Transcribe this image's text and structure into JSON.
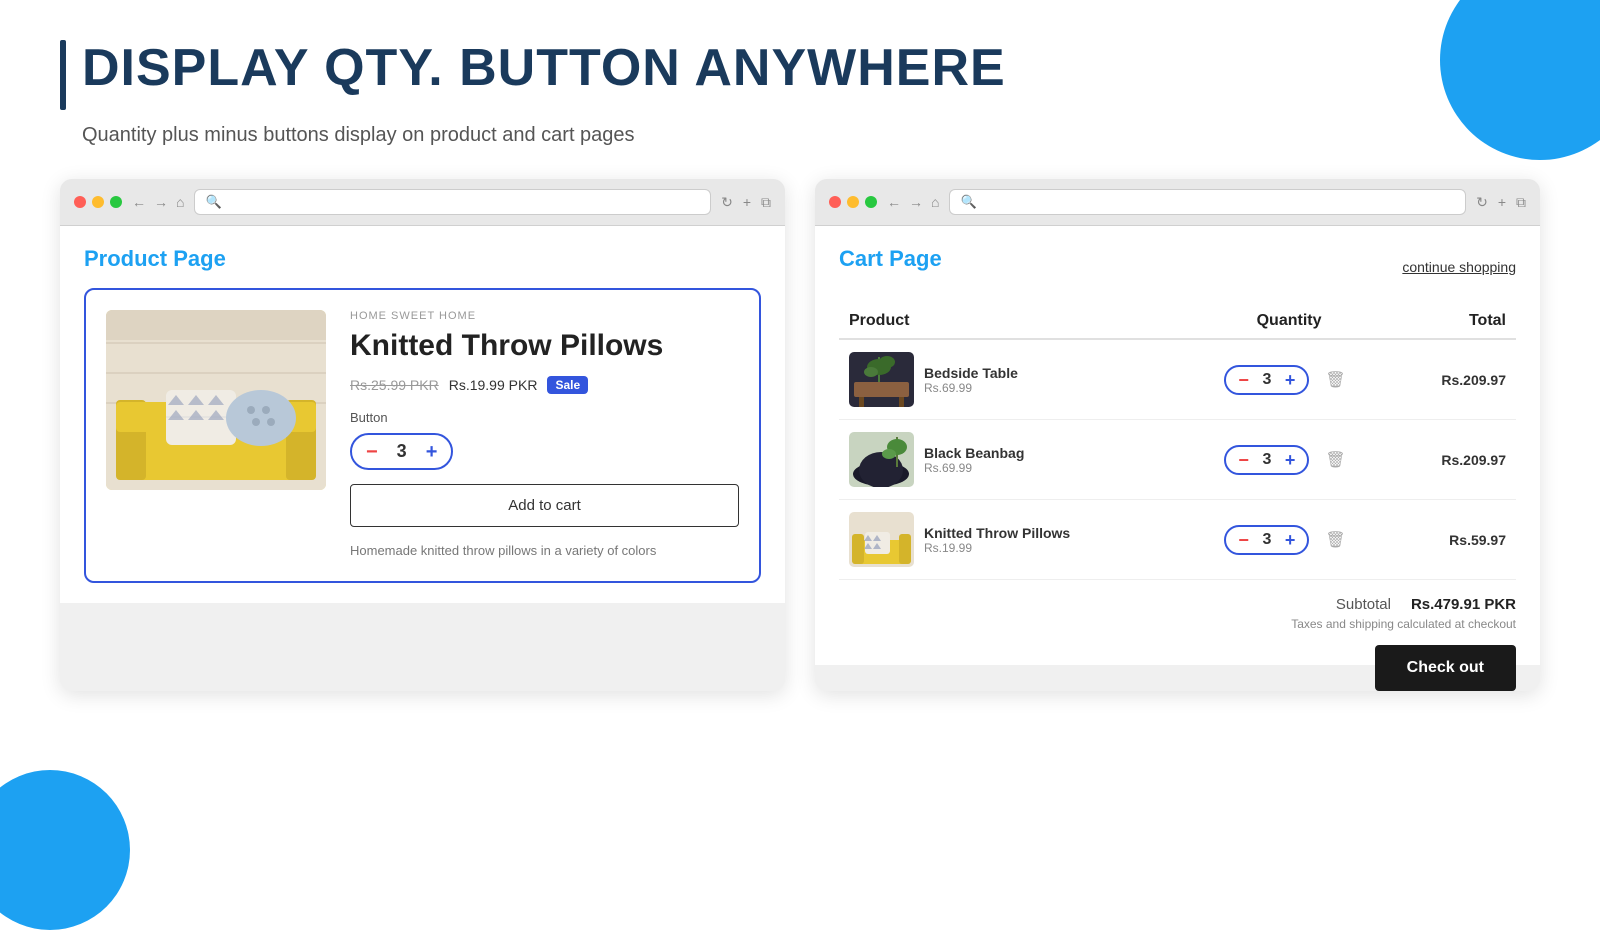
{
  "page": {
    "title": "DISPLAY QTY. BUTTON ANYWHERE",
    "subtitle": "Quantity plus minus buttons display on product and cart pages"
  },
  "decorations": {
    "top_right_color": "#1da1f2",
    "bottom_left_color": "#1da1f2"
  },
  "product_page": {
    "label": "Product Page",
    "browser": {
      "search_placeholder": "Search"
    },
    "product": {
      "brand": "HOME SWEET HOME",
      "name": "Knitted Throw Pillows",
      "price_old": "Rs.25.99 PKR",
      "price_new": "Rs.19.99 PKR",
      "badge": "Sale",
      "button_label": "Button",
      "qty": "3",
      "add_to_cart": "Add to cart",
      "description": "Homemade knitted throw pillows in a variety of colors"
    }
  },
  "cart_page": {
    "label": "Cart Page",
    "continue_shopping": "continue shopping",
    "browser": {
      "search_placeholder": "Search"
    },
    "table": {
      "headers": [
        "Product",
        "Quantity",
        "Total"
      ],
      "items": [
        {
          "name": "Bedside Table",
          "price": "Rs.69.99",
          "qty": "3",
          "total": "Rs.209.97",
          "color": "#c8a96e"
        },
        {
          "name": "Black Beanbag",
          "price": "Rs.69.99",
          "qty": "3",
          "total": "Rs.209.97",
          "color": "#5a7a5a"
        },
        {
          "name": "Knitted Throw Pillows",
          "price": "Rs.19.99",
          "qty": "3",
          "total": "Rs.59.97",
          "color": "#e8d060"
        }
      ]
    },
    "subtotal_label": "Subtotal",
    "subtotal_value": "Rs.479.91 PKR",
    "tax_note": "Taxes and shipping calculated at checkout",
    "checkout_btn": "Check out"
  }
}
